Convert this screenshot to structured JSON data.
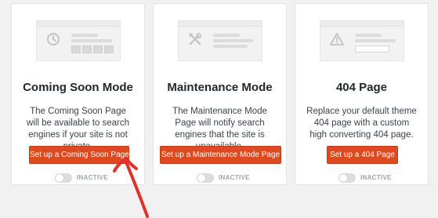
{
  "cards": [
    {
      "title": "Coming Soon Mode",
      "description": "The Coming Soon Page will be available to search engines if your site is not private.",
      "button_label": "Set up a Coming Soon Page",
      "status": "INACTIVE",
      "icon": "clock-icon"
    },
    {
      "title": "Maintenance Mode",
      "description": "The Maintenance Mode Page will notify search engines that the site is unavailable.",
      "button_label": "Set up a Maintenance Mode Page",
      "status": "INACTIVE",
      "icon": "tools-icon"
    },
    {
      "title": "404 Page",
      "description": "Replace your default theme 404 page with a custom high converting 404 page.",
      "button_label": "Set up a 404 Page",
      "status": "INACTIVE",
      "icon": "warning-icon"
    }
  ],
  "colors": {
    "button": "#dd4a1f",
    "annotation_arrow": "#e0312b",
    "background": "#f1f1f1"
  }
}
